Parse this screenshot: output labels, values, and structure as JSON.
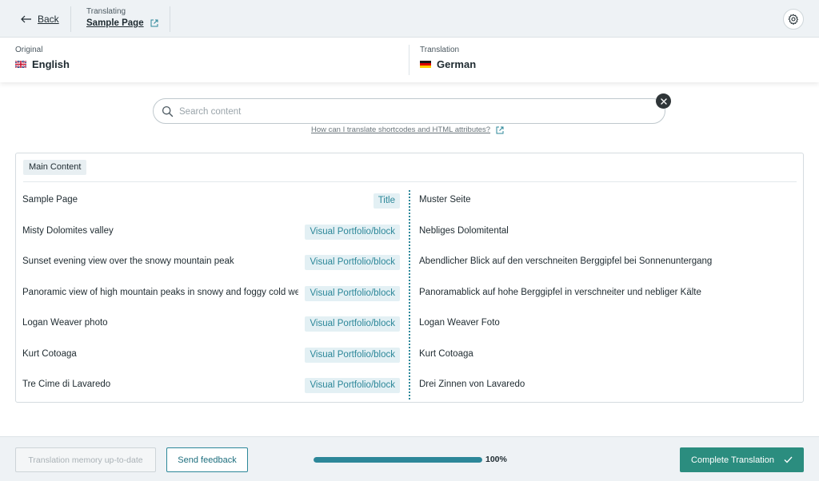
{
  "header": {
    "back_label": "Back",
    "translating_caption": "Translating",
    "page_title": "Sample Page"
  },
  "languages": {
    "original_caption": "Original",
    "original_name": "English",
    "translation_caption": "Translation",
    "translation_name": "German"
  },
  "search": {
    "placeholder": "Search content",
    "value": "",
    "help_link": "How can I translate shortcodes and HTML attributes?"
  },
  "section": {
    "label": "Main Content",
    "rows": [
      {
        "source": "Sample Page",
        "type": "Title",
        "target": "Muster Seite"
      },
      {
        "source": "Misty Dolomites valley",
        "type": "Visual Portfolio/block",
        "target": "Nebliges Dolomitental"
      },
      {
        "source": "Sunset evening view over the snowy mountain peak",
        "type": "Visual Portfolio/block",
        "target": "Abendlicher Blick auf den verschneiten Berggipfel bei Sonnenuntergang"
      },
      {
        "source": "Panoramic view of high mountain peaks in snowy and foggy cold we",
        "type": "Visual Portfolio/block",
        "target": "Panoramablick auf hohe Berggipfel in verschneiter und nebliger Kälte"
      },
      {
        "source": "Logan Weaver photo",
        "type": "Visual Portfolio/block",
        "target": "Logan Weaver Foto"
      },
      {
        "source": "Kurt Cotoaga",
        "type": "Visual Portfolio/block",
        "target": "Kurt Cotoaga"
      },
      {
        "source": "Tre Cime di Lavaredo",
        "type": "Visual Portfolio/block",
        "target": "Drei Zinnen von Lavaredo"
      }
    ]
  },
  "footer": {
    "memory_label": "Translation memory up-to-date",
    "feedback_label": "Send feedback",
    "progress_percent": 100,
    "progress_label": "100%",
    "complete_label": "Complete Translation"
  },
  "icons": {
    "back": "arrow-left-icon",
    "external": "external-link-icon",
    "settings": "gear-icon",
    "search": "search-icon",
    "clear": "close-icon",
    "complete": "check-icon",
    "flag_original": "uk-flag-icon",
    "flag_translation": "germany-flag-icon"
  },
  "colors": {
    "accent": "#2c8799",
    "complete_button": "#2b8d7f",
    "header_bg": "#eef2f5"
  }
}
